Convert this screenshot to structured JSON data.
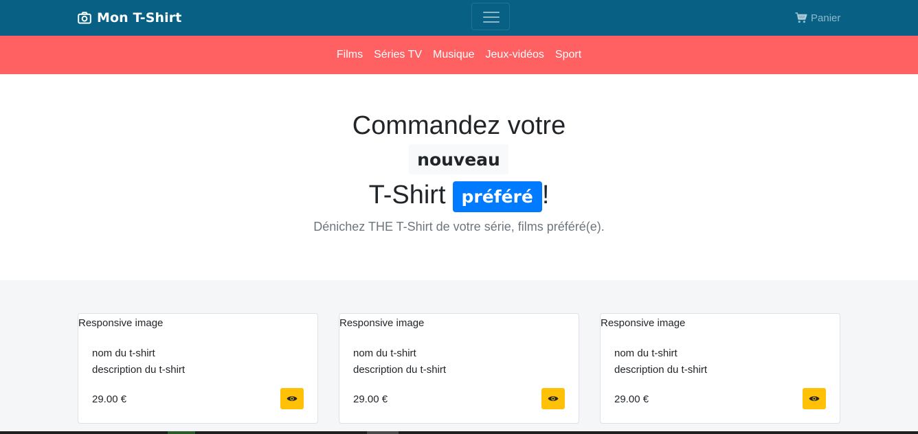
{
  "navbar": {
    "brand": "Mon T-Shirt",
    "brand_icon": "camera-icon",
    "cart_label": "Panier",
    "cart_icon": "shopping-cart-icon",
    "toggler_icon": "hamburger-menu-icon",
    "bg_color": "#086185"
  },
  "categories": {
    "bg_color": "#ff6061",
    "items": [
      "Films",
      "Séries TV",
      "Musique",
      "Jeux-vidéos",
      "Sport"
    ]
  },
  "hero": {
    "line1": "Commandez votre",
    "badge_new": "nouveau",
    "line3_prefix": "T-Shirt",
    "badge_favorite": "préféré",
    "line3_suffix": "!",
    "lead": "Dénichez THE T-Shirt de votre série, films préféré(e)."
  },
  "products": [
    {
      "image_alt": "Responsive image",
      "name": "nom du t-shirt",
      "description": "description du t-shirt",
      "price": "29.00 €",
      "button_icon": "eye-icon"
    },
    {
      "image_alt": "Responsive image",
      "name": "nom du t-shirt",
      "description": "description du t-shirt",
      "price": "29.00 €",
      "button_icon": "eye-icon"
    },
    {
      "image_alt": "Responsive image",
      "name": "nom du t-shirt",
      "description": "description du t-shirt",
      "price": "29.00 €",
      "button_icon": "eye-icon"
    }
  ],
  "colors": {
    "primary": "#007bff",
    "warning": "#ffc107",
    "light": "#f8f9fa"
  }
}
